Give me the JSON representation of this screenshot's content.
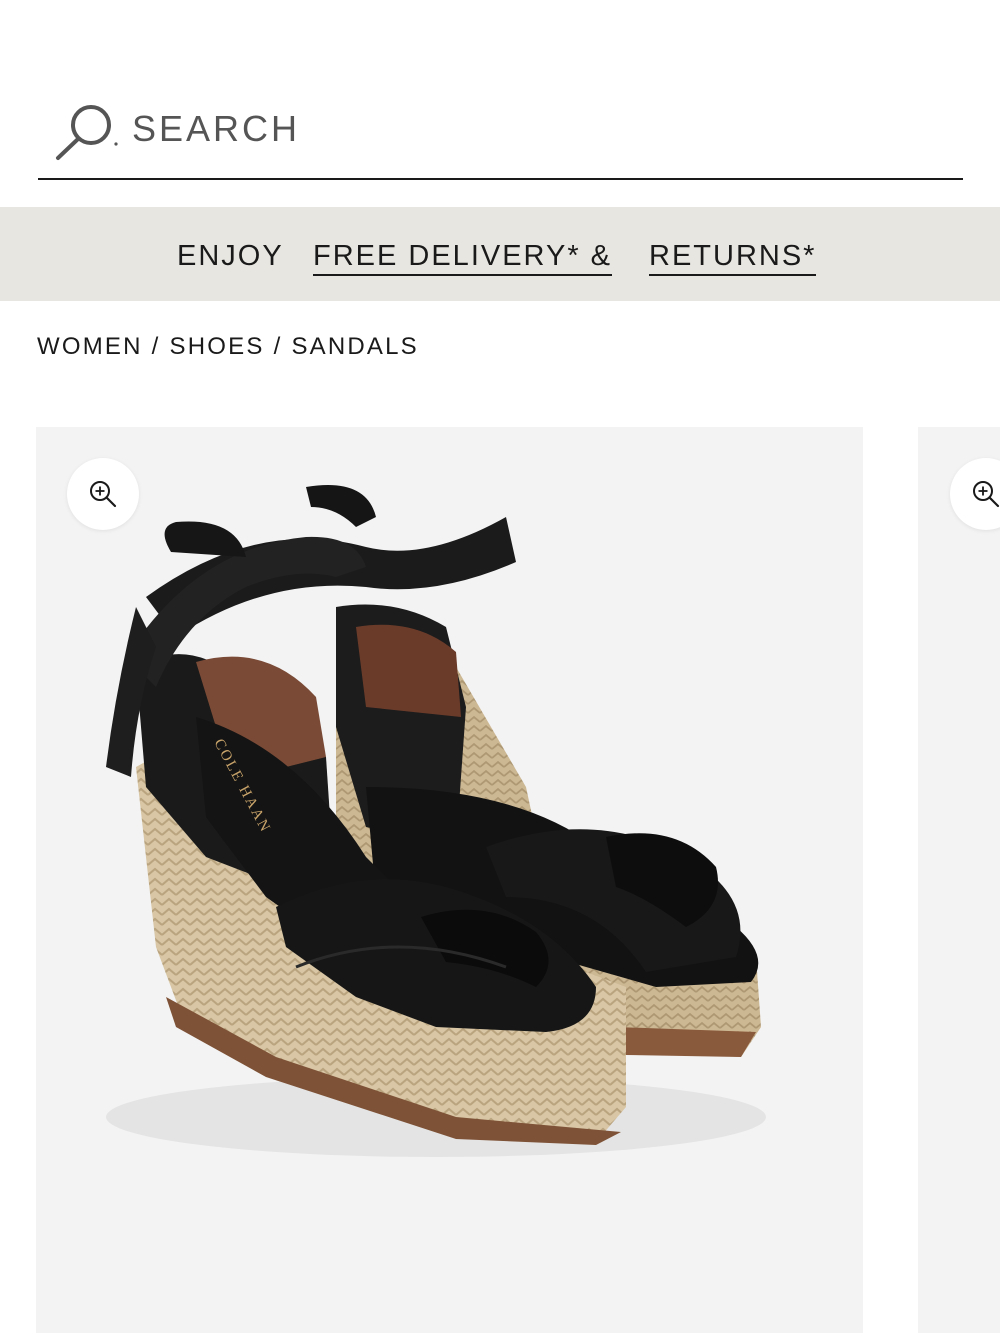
{
  "search": {
    "label": "SEARCH",
    "icon": "search-icon"
  },
  "promo": {
    "enjoy": "ENJOY",
    "delivery_link": "FREE DELIVERY* &",
    "returns_link": "RETURNS*"
  },
  "breadcrumb": {
    "items": [
      "WOMEN",
      "SHOES",
      "SANDALS"
    ],
    "separator": "/"
  },
  "gallery": {
    "zoom_icon": "zoom-in-icon",
    "product_image": {
      "brand_imprint": "COLE HAAN",
      "description": "black knotted leather espadrille wedge sandals with ankle wrap ties"
    }
  },
  "colors": {
    "banner_bg": "#e8e6e0",
    "gallery_bg": "#f3f3f3",
    "text": "#1a1a1a"
  }
}
